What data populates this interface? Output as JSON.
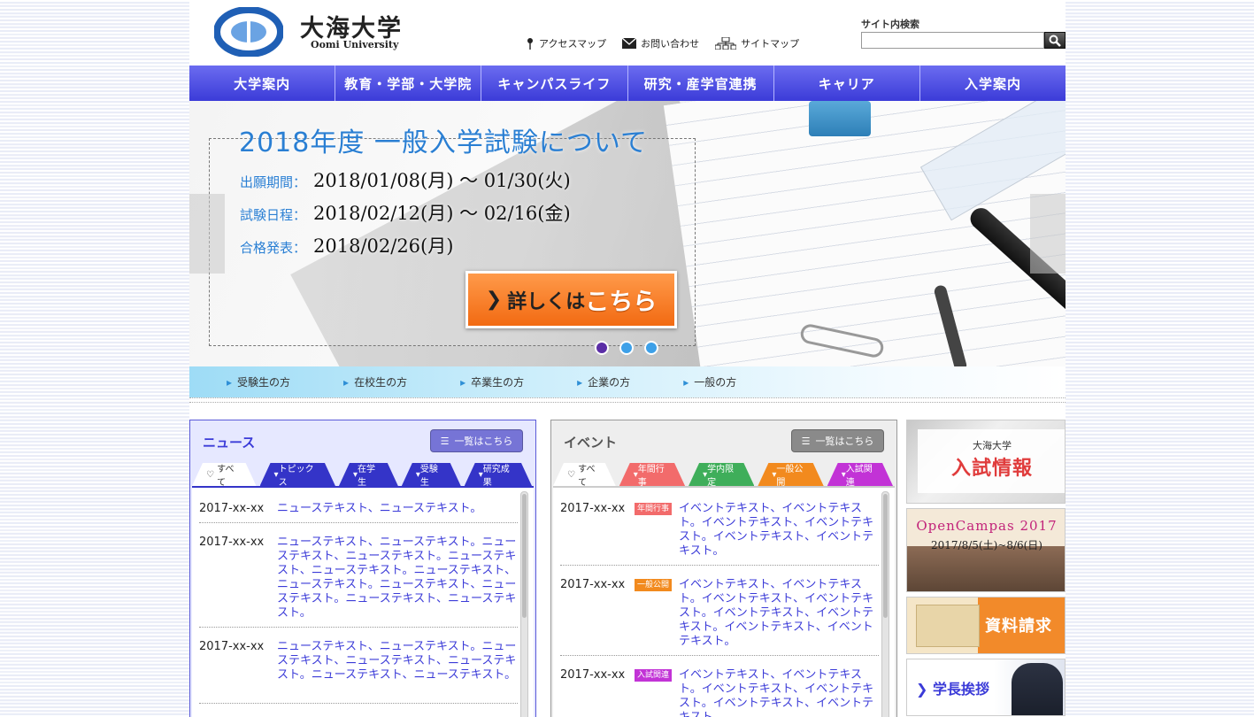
{
  "header": {
    "title": "大海大学",
    "subtitle": "Oomi University",
    "links": [
      {
        "label": "アクセスマップ",
        "icon": "map-pin-icon"
      },
      {
        "label": "お問い合わせ",
        "icon": "mail-icon"
      },
      {
        "label": "サイトマップ",
        "icon": "sitemap-icon"
      }
    ],
    "search": {
      "label": "サイト内検索",
      "value": "",
      "placeholder": ""
    }
  },
  "gnav": [
    "大学案内",
    "教育・学部・大学院",
    "キャンパスライフ",
    "研究・産学官連携",
    "キャリア",
    "入学案内"
  ],
  "hero": {
    "title": "2018年度 一般入学試験について",
    "rows": [
      {
        "label": "出願期間：",
        "value": "2018/01/08(月) ～ 01/30(火)"
      },
      {
        "label": "試験日程：",
        "value": "2018/02/12(月) ～ 02/16(金)"
      },
      {
        "label": "合格発表：",
        "value": "2018/02/26(月)"
      }
    ],
    "button_small": "詳しくは",
    "button_big": "こちら",
    "slides": 3,
    "active_slide": 1
  },
  "subnav": [
    "受験生の方",
    "在校生の方",
    "卒業生の方",
    "企業の方",
    "一般の方"
  ],
  "news": {
    "title": "ニュース",
    "list_button": "一覧はこちら",
    "tabs": [
      "すべて",
      "トピックス",
      "在学生",
      "受験生",
      "研究成果"
    ],
    "items": [
      {
        "date": "2017-xx-xx",
        "text": "ニューステキスト、ニューステキスト。"
      },
      {
        "date": "2017-xx-xx",
        "text": "ニューステキスト、ニューステキスト。ニューステキスト、ニューステキスト。ニューステキスト、ニューステキスト。ニューステキスト、ニューステキスト。ニューステキスト、ニューステキスト。ニューステキスト、ニューステキスト。"
      },
      {
        "date": "2017-xx-xx",
        "text": "ニューステキスト、ニューステキスト。ニューステキスト、ニューステキスト、ニューステキスト。ニューステキスト、ニューステキスト。"
      }
    ]
  },
  "event": {
    "title": "イベント",
    "list_button": "一覧はこちら",
    "tabs": [
      "すべて",
      "年間行事",
      "学内限定",
      "一般公開",
      "入試関連"
    ],
    "tab_colors": [
      "#ffffff",
      "#f26b6b",
      "#3fae5a",
      "#f28a1e",
      "#c233d6"
    ],
    "items": [
      {
        "date": "2017-xx-xx",
        "badge": "年間行事",
        "badge_color": "#f26b6b",
        "text": "イベントテキスト、イベントテキスト。イベントテキスト、イベントテキスト。イベントテキスト、イベントテキスト。"
      },
      {
        "date": "2017-xx-xx",
        "badge": "一般公開",
        "badge_color": "#f28a1e",
        "text": "イベントテキスト、イベントテキスト。イベントテキスト、イベントテキスト。イベントテキスト、イベントテキスト。イベントテキスト、イベントテキスト。"
      },
      {
        "date": "2017-xx-xx",
        "badge": "入試関連",
        "badge_color": "#c233d6",
        "text": "イベントテキスト、イベントテキスト。イベントテキスト、イベントテキスト。イベントテキスト、イベントテキスト。"
      }
    ]
  },
  "sidebar": {
    "exam": {
      "small": "大海大学",
      "big": "入試情報"
    },
    "open_campus": {
      "title": "OpenCampas 2017",
      "dates": "2017/8/5(土)~8/6(日)"
    },
    "request": "資料請求",
    "greeting": "学長挨拶"
  },
  "colors": {
    "nav": "#4b4be0",
    "accent": "#3b3bd8",
    "hero_blue": "#2a7fd3",
    "orange": "#f26a12"
  }
}
